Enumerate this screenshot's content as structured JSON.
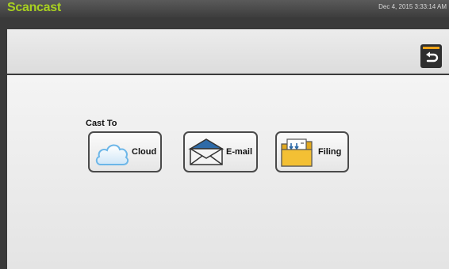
{
  "app": {
    "title": "Scancast",
    "datetime": "Dec 4, 2015 3:33:14 AM"
  },
  "main": {
    "section_label": "Cast To",
    "buttons": [
      {
        "label": "Cloud",
        "icon": "cloud-icon"
      },
      {
        "label": "E-mail",
        "icon": "envelope-icon"
      },
      {
        "label": "Filing",
        "icon": "folder-icon"
      }
    ]
  },
  "colors": {
    "title_accent": "#a8d020",
    "back_accent": "#f0a418",
    "cloud_blue": "#6cb6e8",
    "folder_yellow": "#f3c034"
  }
}
